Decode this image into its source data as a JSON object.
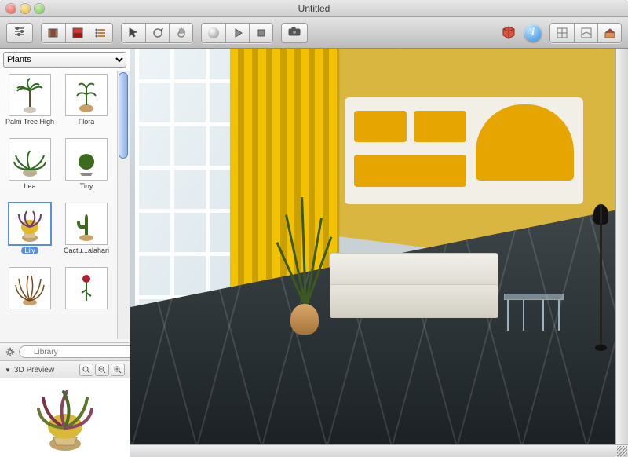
{
  "window": {
    "title": "Untitled"
  },
  "toolbar": {
    "groups_left": [
      "view-controls",
      "library-toggle",
      "color-toggle",
      "list-toggle"
    ],
    "groups_center_a": [
      "pointer",
      "rotate",
      "pan"
    ],
    "groups_center_b": [
      "record",
      "play",
      "stop"
    ],
    "camera_label": "camera",
    "right": [
      "package",
      "info",
      "layout-a",
      "layout-b",
      "home"
    ]
  },
  "sidebar": {
    "category_selected": "Plants",
    "items": [
      {
        "label": "Palm Tree High",
        "selected": false
      },
      {
        "label": "Flora",
        "selected": false
      },
      {
        "label": "Lea",
        "selected": false
      },
      {
        "label": "Tiny",
        "selected": false
      },
      {
        "label": "Lily",
        "selected": true
      },
      {
        "label": "Cactu...alahari",
        "selected": false
      },
      {
        "label": "",
        "selected": false
      },
      {
        "label": "",
        "selected": false
      }
    ],
    "search_placeholder": "Library",
    "preview_label": "3D Preview",
    "zoom_icons": [
      "zoom-fit",
      "zoom-out",
      "zoom-in"
    ]
  },
  "colors": {
    "accent_wall": "#d8b640",
    "curtain": "#f2c200",
    "shelf_inset": "#e6a500",
    "floor_dark": "#242b2e",
    "selection": "#5b8fdc"
  }
}
